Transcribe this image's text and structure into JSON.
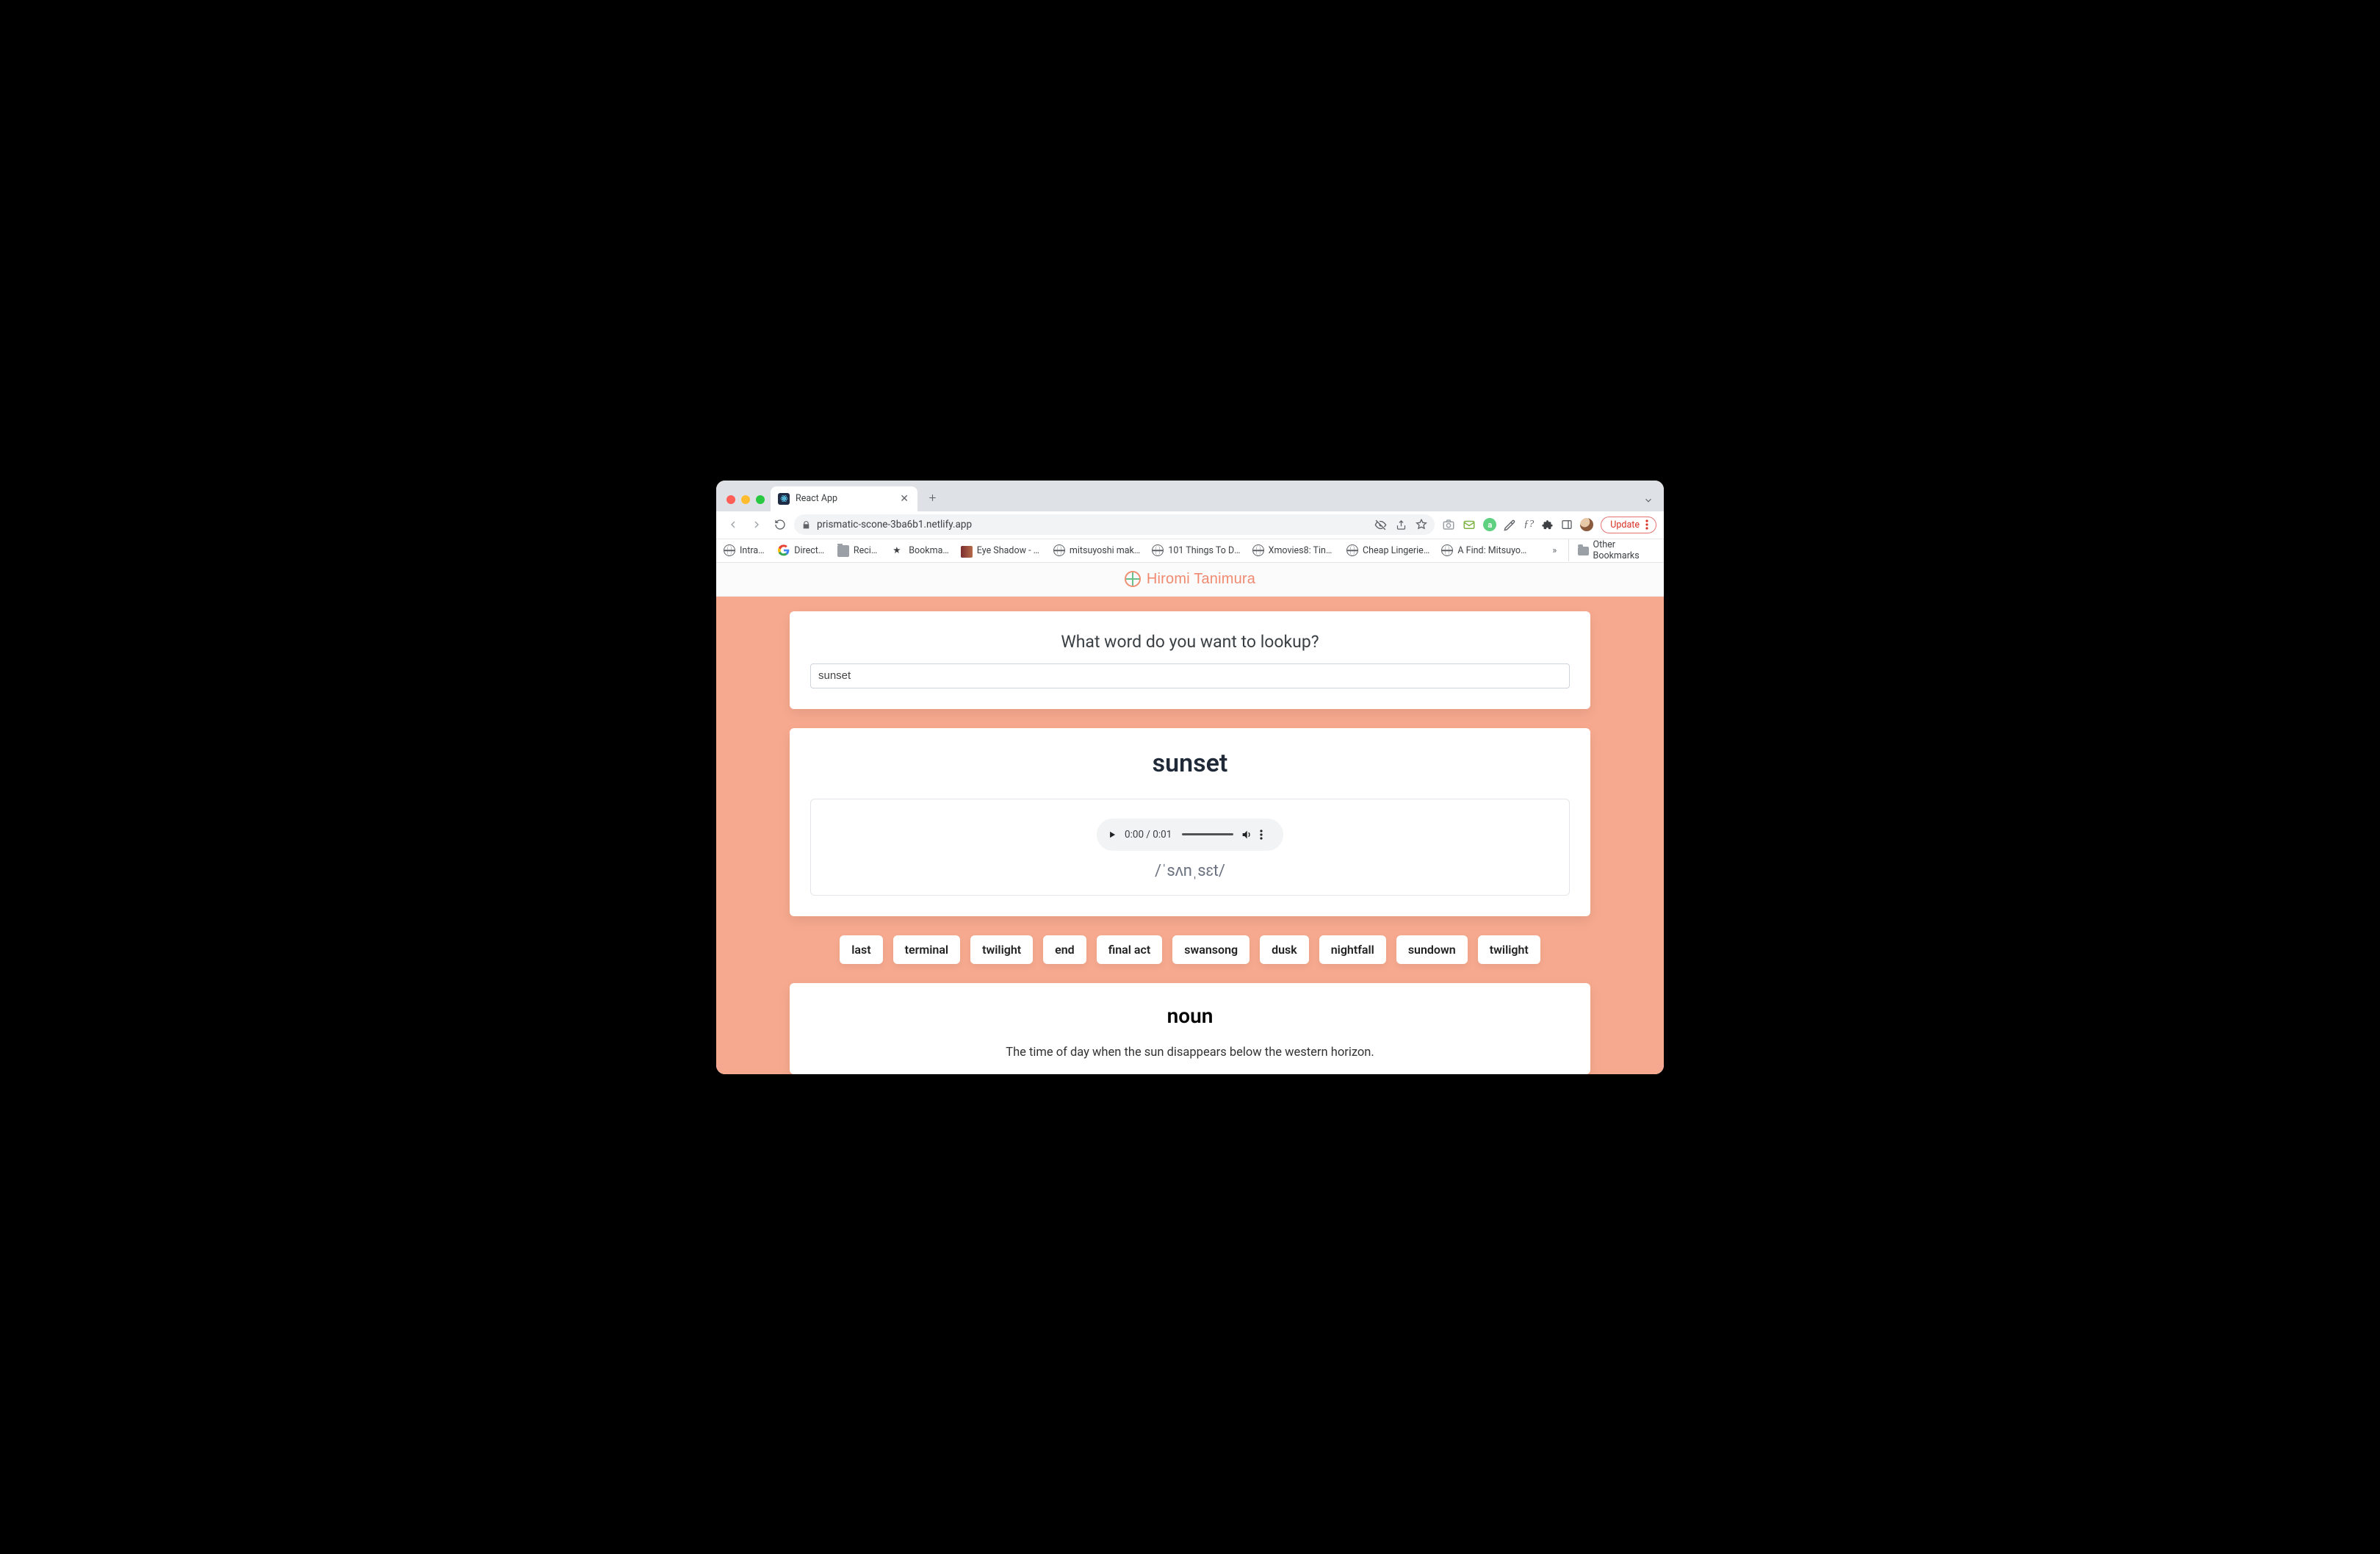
{
  "browser": {
    "tab": {
      "title": "React App"
    },
    "url": "prismatic-scone-3ba6b1.netlify.app",
    "update_label": "Update",
    "bookmarks": [
      {
        "icon": "globe",
        "label": "Intranet"
      },
      {
        "icon": "google",
        "label": "Directory"
      },
      {
        "icon": "folder",
        "label": "Recipes"
      },
      {
        "icon": "star",
        "label": "Bookmarks"
      },
      {
        "icon": "swatch",
        "label": "Eye Shadow - Co…"
      },
      {
        "icon": "globe",
        "label": "mitsuyoshi makeu…"
      },
      {
        "icon": "globe",
        "label": "101 Things To Do I…"
      },
      {
        "icon": "globe",
        "label": "Xmovies8: Tinker…"
      },
      {
        "icon": "globe",
        "label": "Cheap Lingerie, S…"
      },
      {
        "icon": "globe",
        "label": "A Find: Mitsuyoshi…"
      }
    ],
    "other_bookmarks_label": "Other Bookmarks"
  },
  "app": {
    "header_name": "Hiromi Tanimura",
    "search": {
      "prompt": "What word do you want to lookup?",
      "value": "sunset"
    },
    "result": {
      "word": "sunset",
      "audio": {
        "time": "0:00 / 0:01"
      },
      "phonetic": "/ˈsʌnˌsɛt/"
    },
    "synonyms": [
      "last",
      "terminal",
      "twilight",
      "end",
      "final act",
      "swansong",
      "dusk",
      "nightfall",
      "sundown",
      "twilight"
    ],
    "definition": {
      "part_of_speech": "noun",
      "text": "The time of day when the sun disappears below the western horizon."
    }
  }
}
